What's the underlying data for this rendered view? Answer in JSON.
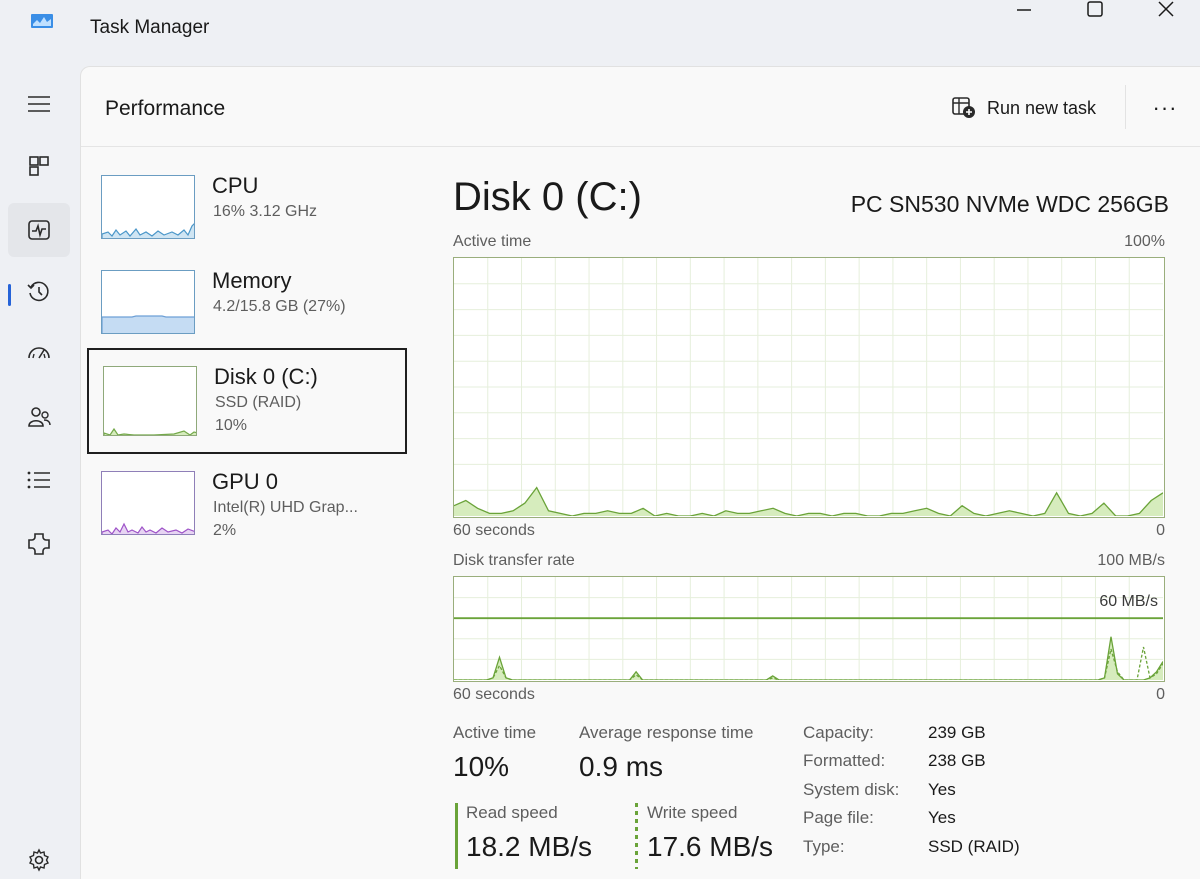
{
  "window": {
    "title": "Task Manager",
    "icon": "task-manager-icon",
    "controls": {
      "minimize": "minimize-icon",
      "maximize": "maximize-icon",
      "close": "close-icon"
    }
  },
  "nav": {
    "items": [
      "menu-icon",
      "processes-icon",
      "performance-icon",
      "app-history-icon",
      "startup-apps-icon",
      "users-icon",
      "details-icon",
      "services-icon",
      "settings-icon"
    ],
    "selected": "performance-icon",
    "accent": "#2563d8"
  },
  "header": {
    "title": "Performance",
    "run_new_task": "Run new task",
    "more": "···"
  },
  "perf_list": [
    {
      "name": "CPU",
      "line1": "16% 3.12 GHz",
      "line2": "",
      "color": "#4b97c9"
    },
    {
      "name": "Memory",
      "line1": "4.2/15.8 GB (27%)",
      "line2": "",
      "color": "#6ea0d6"
    },
    {
      "name": "Disk 0 (C:)",
      "line1": "SSD (RAID)",
      "line2": "10%",
      "color": "#74a94a",
      "selected": true
    },
    {
      "name": "GPU 0",
      "line1": "Intel(R) UHD Grap...",
      "line2": "2%",
      "color": "#9e53c8"
    }
  ],
  "detail": {
    "title": "Disk 0 (C:)",
    "model": "PC SN530 NVMe WDC 256GB",
    "active_graph": {
      "label": "Active time",
      "max": "100%",
      "time_label": "60 seconds",
      "min": "0",
      "samples_pct": [
        4,
        6,
        3,
        1,
        1,
        2,
        5,
        11,
        2,
        1,
        0,
        1,
        1,
        2,
        1,
        1,
        3,
        0,
        1,
        0,
        0,
        1,
        0,
        2,
        1,
        1,
        2,
        3,
        1,
        0,
        1,
        1,
        0,
        1,
        1,
        0,
        0,
        1,
        1,
        2,
        3,
        1,
        0,
        4,
        1,
        0,
        1,
        2,
        1,
        0,
        1,
        9,
        1,
        0,
        1,
        5,
        0,
        0,
        1,
        6,
        9
      ]
    },
    "transfer_graph": {
      "label": "Disk transfer rate",
      "max": "100 MB/s",
      "time_label": "60 seconds",
      "min": "0",
      "scale_line": "60 MB/s",
      "read_mbps": [
        0,
        0,
        0,
        0,
        0,
        0,
        2,
        22,
        2,
        0,
        0,
        0,
        0,
        0,
        0,
        0,
        0,
        0,
        0,
        0,
        0,
        0,
        0,
        0,
        0,
        0,
        0,
        0,
        8,
        0,
        0,
        0,
        0,
        0,
        0,
        0,
        0,
        0,
        0,
        0,
        0,
        0,
        0,
        0,
        0,
        0,
        0,
        0,
        0,
        4,
        0,
        0,
        0,
        0,
        0,
        0,
        0,
        0,
        0,
        0,
        0,
        0,
        0,
        0,
        0,
        0,
        0,
        0,
        0,
        0,
        0,
        0,
        0,
        0,
        0,
        0,
        0,
        0,
        0,
        0,
        0,
        0,
        0,
        0,
        0,
        0,
        0,
        0,
        0,
        0,
        0,
        0,
        0,
        0,
        0,
        0,
        0,
        0,
        0,
        0,
        2,
        42,
        6,
        0,
        0,
        0,
        0,
        2,
        8,
        18
      ],
      "write_mbps": [
        0,
        0,
        0,
        0,
        0,
        0,
        2,
        14,
        2,
        0,
        0,
        0,
        0,
        0,
        0,
        0,
        0,
        0,
        0,
        0,
        0,
        0,
        0,
        0,
        0,
        0,
        0,
        0,
        5,
        0,
        0,
        0,
        0,
        0,
        0,
        0,
        0,
        0,
        0,
        0,
        0,
        0,
        0,
        0,
        0,
        0,
        0,
        0,
        0,
        2,
        0,
        0,
        0,
        0,
        0,
        0,
        0,
        0,
        0,
        0,
        0,
        0,
        0,
        0,
        0,
        0,
        0,
        0,
        0,
        0,
        0,
        0,
        0,
        0,
        0,
        0,
        0,
        0,
        0,
        0,
        0,
        0,
        0,
        0,
        0,
        0,
        0,
        0,
        0,
        0,
        0,
        0,
        0,
        0,
        0,
        0,
        0,
        0,
        0,
        0,
        2,
        30,
        8,
        0,
        0,
        0,
        32,
        2,
        6,
        16
      ]
    },
    "stats": {
      "active_time_label": "Active time",
      "active_time": "10%",
      "avg_response_label": "Average response time",
      "avg_response": "0.9 ms",
      "read_label": "Read speed",
      "read": "18.2 MB/s",
      "write_label": "Write speed",
      "write": "17.6 MB/s"
    },
    "info": [
      {
        "label": "Capacity:",
        "value": "239 GB"
      },
      {
        "label": "Formatted:",
        "value": "238 GB"
      },
      {
        "label": "System disk:",
        "value": "Yes"
      },
      {
        "label": "Page file:",
        "value": "Yes"
      },
      {
        "label": "Type:",
        "value": "SSD (RAID)"
      }
    ],
    "colors": {
      "line": "#6aa339",
      "fill": "#d6ecbd",
      "grid": "#e6efdc",
      "border": "#9aae7c"
    }
  }
}
